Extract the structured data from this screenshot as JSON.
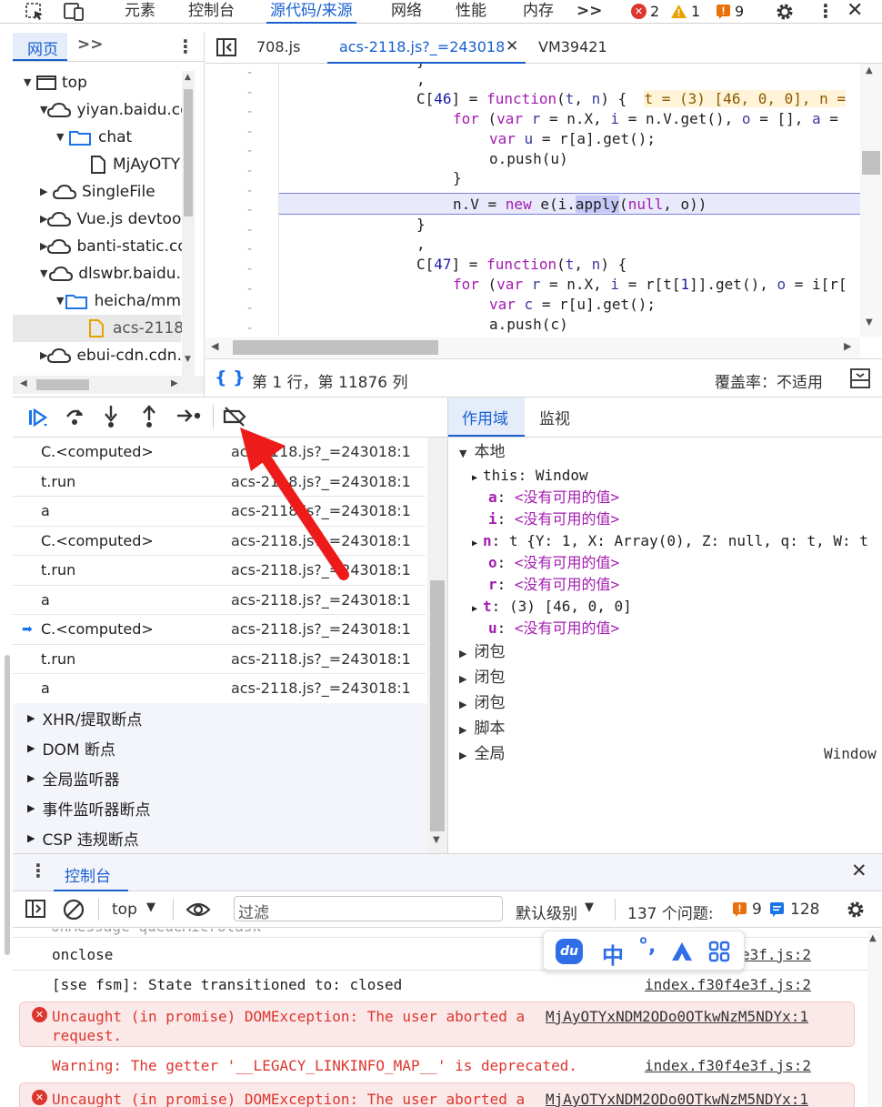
{
  "topbar": {
    "tabs": [
      "元素",
      "控制台",
      "源代码/来源",
      "网络",
      "性能",
      "内存"
    ],
    "more": ">>",
    "errors": "2",
    "warnings": "1",
    "issues": "9"
  },
  "navigator": {
    "tab_label": "网页",
    "more": ">>",
    "items": [
      {
        "label": "top"
      },
      {
        "label": "yiyan.baidu.co"
      },
      {
        "label": "chat"
      },
      {
        "label": "MjAyOTY"
      },
      {
        "label": "SingleFile"
      },
      {
        "label": "Vue.js devtoo"
      },
      {
        "label": "banti-static.co"
      },
      {
        "label": "dlswbr.baidu."
      },
      {
        "label": "heicha/mm"
      },
      {
        "label": "acs-2118"
      },
      {
        "label": "ebui-cdn.cdn."
      }
    ]
  },
  "editor": {
    "tabs": [
      "708.js",
      "acs-2118.js?_=243018",
      "VM39421"
    ],
    "inline_hint": "t = (3) [46, 0, 0], n =",
    "status_position": "第 1 行，第 11876 列",
    "coverage": "覆盖率：不适用"
  },
  "callstack": [
    {
      "fn": "C.<computed>",
      "loc": "acs-2118.js?_=243018:1"
    },
    {
      "fn": "t.run",
      "loc": "acs-2118.js?_=243018:1"
    },
    {
      "fn": "a",
      "loc": "acs-2118.js?_=243018:1"
    },
    {
      "fn": "C.<computed>",
      "loc": "acs-2118.js?_=243018:1"
    },
    {
      "fn": "t.run",
      "loc": "acs-2118.js?_=243018:1"
    },
    {
      "fn": "a",
      "loc": "acs-2118.js?_=243018:1"
    },
    {
      "fn": "C.<computed>",
      "loc": "acs-2118.js?_=243018:1"
    },
    {
      "fn": "t.run",
      "loc": "acs-2118.js?_=243018:1"
    },
    {
      "fn": "a",
      "loc": "acs-2118.js?_=243018:1"
    }
  ],
  "breakpoints": [
    "XHR/提取断点",
    "DOM 断点",
    "全局监听器",
    "事件监听器断点",
    "CSP 违规断点"
  ],
  "scope": {
    "tabs": [
      "作用域",
      "监视"
    ],
    "local_label": "本地",
    "this_label": "this: Window",
    "na": "<没有可用的值>",
    "n_value": "t {Y: 1, X: Array(0), Z: null, q: t, W: t",
    "t_value": "(3) [46, 0, 0]",
    "closures": [
      "闭包",
      "闭包",
      "闭包"
    ],
    "script_label": "脚本",
    "global_label": "全局",
    "global_value": "Window"
  },
  "console": {
    "drawer_tab": "控制台",
    "context": "top",
    "filter_placeholder": "过滤",
    "level": "默认级别",
    "issues_label": "137 个问题:",
    "issue_warn": "9",
    "issue_info": "128",
    "lines": [
      {
        "text": "onclose",
        "src": "index.f30f4e3f.js:2"
      },
      {
        "text": "[sse fsm]: State transitioned to: closed",
        "src": "index.f30f4e3f.js:2"
      },
      {
        "text": "Uncaught (in promise) DOMException: The user aborted a",
        "text2": "request.",
        "src": "MjAyOTYxNDM2ODo0OTkwNzM5NDYx:1"
      },
      {
        "text": "Warning: The getter '__LEGACY_LINKINFO_MAP__' is deprecated.",
        "src": "index.f30f4e3f.js:2"
      },
      {
        "text": "Uncaught (in promise) DOMException: The user aborted a",
        "src": "MjAyOTYxNDM2ODo0OTkwNzM5NDYx:1"
      }
    ]
  },
  "ime": {
    "zh": "中"
  },
  "colors": {
    "accent": "#1a5fd0",
    "error": "#dc362e",
    "warning": "#e8a200",
    "highlight": "#c6c8f7"
  }
}
